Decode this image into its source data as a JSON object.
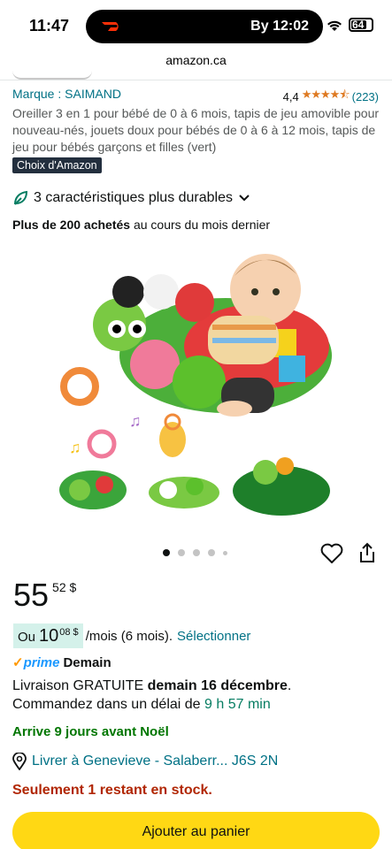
{
  "status": {
    "time": "11:47",
    "eta": "By 12:02",
    "battery": "64"
  },
  "browser": {
    "url": "amazon.ca"
  },
  "product": {
    "brand": "Marque : SAIMAND",
    "rating": "4,4",
    "review_count": "(223)",
    "title": "Oreiller 3 en 1 pour bébé de 0 à 6 mois, tapis de jeu amovible pour nouveau-nés, jouets doux pour bébés de 0 à 6 à 12 mois, tapis de jeu pour bébés garçons et filles (vert)",
    "badge": "Choix d'Amazon",
    "sustainability": "3 caractéristiques plus durables",
    "bought_strong": "Plus de 200 achetés",
    "bought_rest": " au cours du mois dernier"
  },
  "price": {
    "int": "55",
    "frac": "52 $",
    "monthly_prefix": "Ou",
    "monthly_int": "10",
    "monthly_frac": "08 $",
    "monthly_suffix": "/mois (6 mois).",
    "monthly_link": "Sélectionner"
  },
  "delivery": {
    "prime": "prime",
    "prime_day": "Demain",
    "free_label": "Livraison GRATUITE ",
    "free_date": "demain 16 décembre",
    "free_end": ".",
    "order_prefix": "Commandez dans un délai de ",
    "order_time": "9 h 57 min",
    "xmas": "Arrive 9 jours avant Noël",
    "location": "Livrer à Genevieve - Salaberr... J6S 2N",
    "stock": "Seulement 1 restant en stock."
  },
  "actions": {
    "add_to_cart": "Ajouter au panier"
  },
  "carousel": {
    "count": 5,
    "active": 0
  },
  "colors": {
    "link": "#007185",
    "cart": "#ffd814",
    "stock": "#b12704",
    "xmas": "#007600"
  }
}
